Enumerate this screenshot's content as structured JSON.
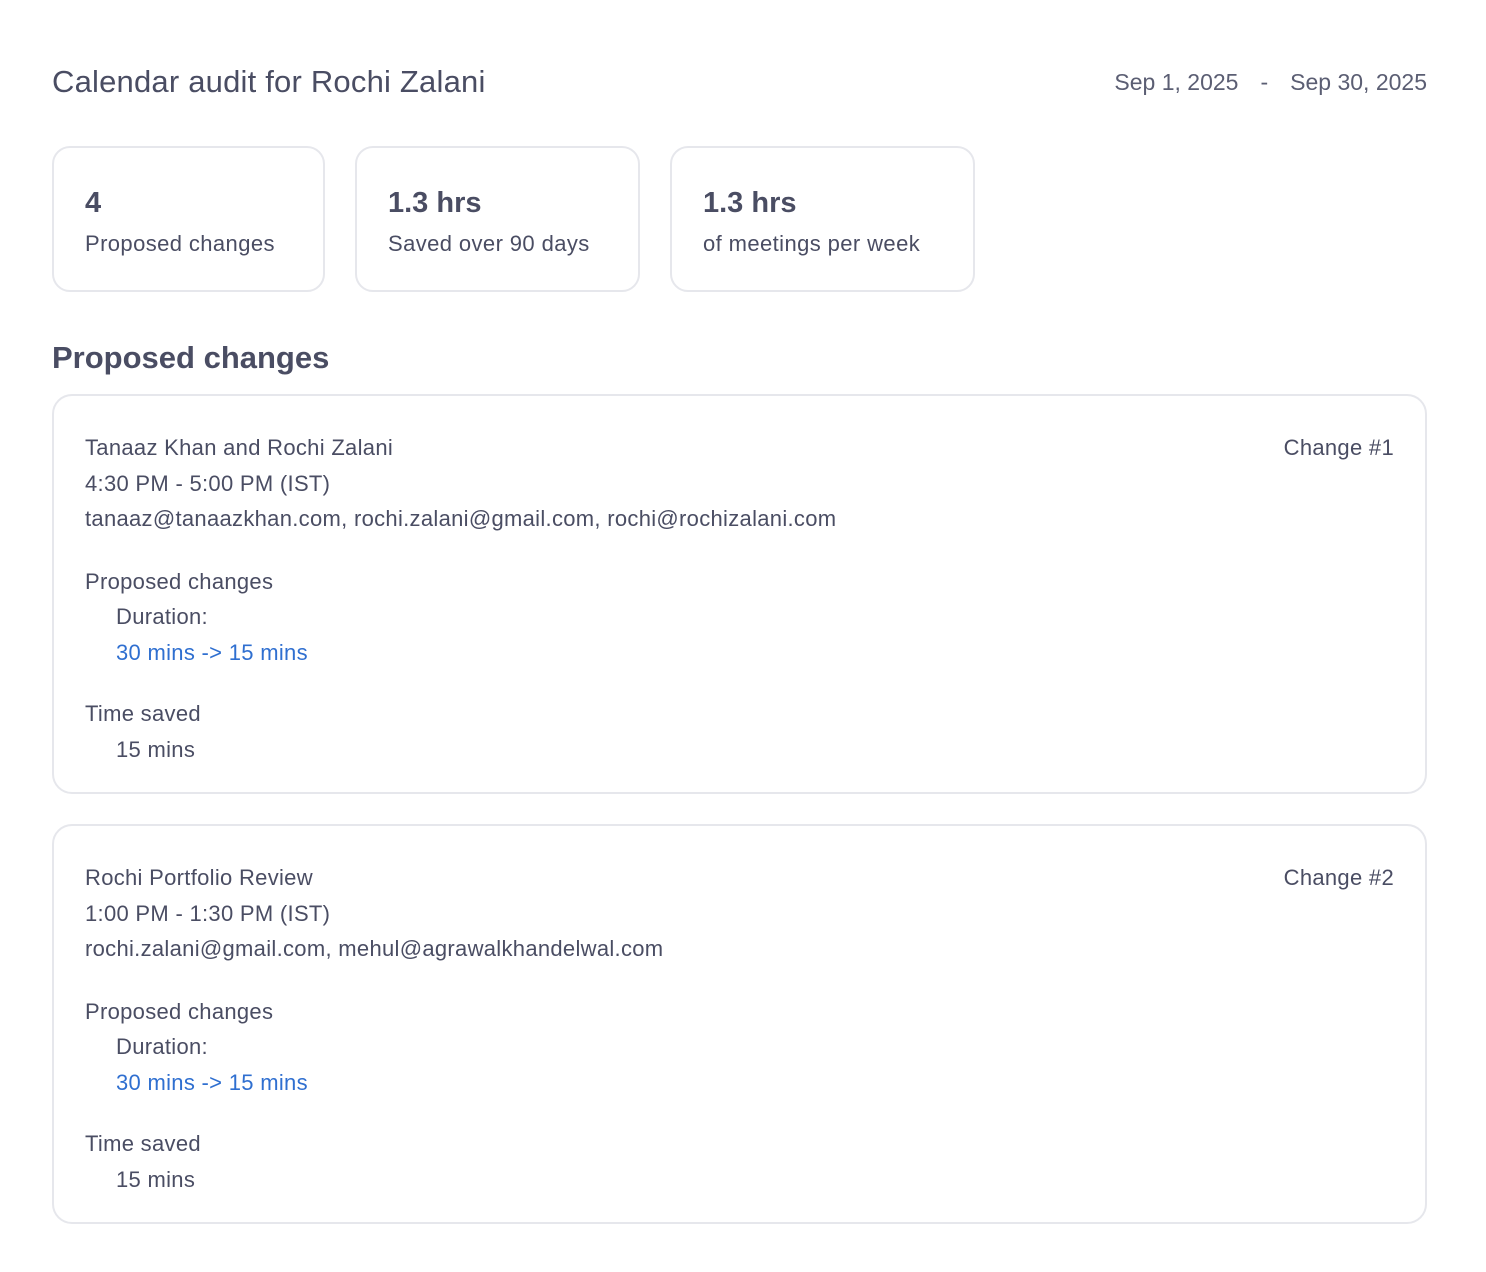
{
  "header": {
    "title": "Calendar audit for Rochi Zalani",
    "date_start": "Sep 1, 2025",
    "date_separator": "-",
    "date_end": "Sep 30, 2025"
  },
  "stats": [
    {
      "value": "4",
      "label": "Proposed changes"
    },
    {
      "value": "1.3 hrs",
      "label": "Saved over 90 days"
    },
    {
      "value": "1.3 hrs",
      "label": "of meetings per week"
    }
  ],
  "section_title": "Proposed changes",
  "changes": [
    {
      "title": "Tanaaz Khan and Rochi Zalani",
      "change_label": "Change #1",
      "time": "4:30 PM  -  5:00 PM  (IST)",
      "attendees": "tanaaz@tanaazkhan.com, rochi.zalani@gmail.com, rochi@rochizalani.com",
      "proposed_label": "Proposed changes",
      "duration_label": "Duration:",
      "duration_change": "30 mins -> 15 mins",
      "time_saved_label": "Time saved",
      "time_saved_value": "15 mins"
    },
    {
      "title": "Rochi Portfolio Review",
      "change_label": "Change #2",
      "time": "1:00 PM  -  1:30 PM  (IST)",
      "attendees": "rochi.zalani@gmail.com, mehul@agrawalkhandelwal.com",
      "proposed_label": "Proposed changes",
      "duration_label": "Duration:",
      "duration_change": "30 mins -> 15 mins",
      "time_saved_label": "Time saved",
      "time_saved_value": "15 mins"
    }
  ],
  "colors": {
    "text": "#4a4d63",
    "accent": "#2f6fd0",
    "border": "#e6e7ec"
  }
}
